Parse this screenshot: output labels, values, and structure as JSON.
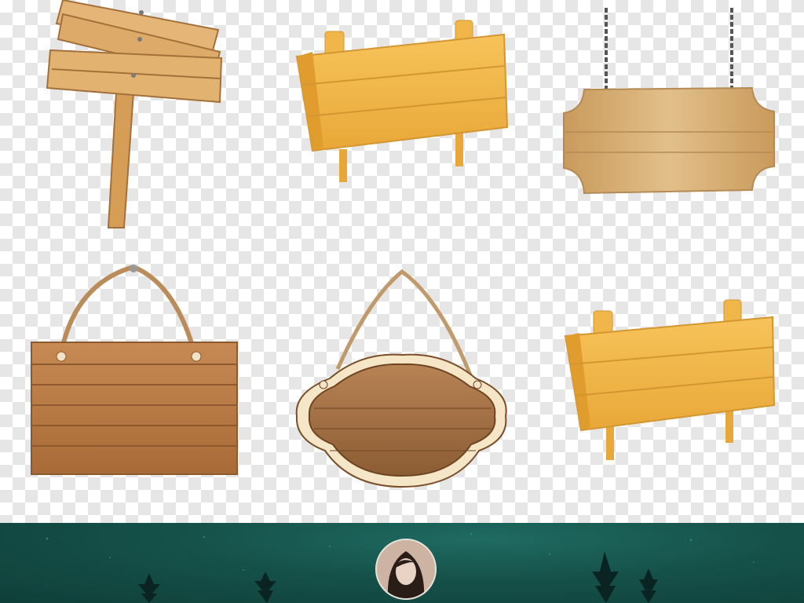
{
  "page": {
    "description": ""
  },
  "images": [
    {
      "name": "wooden-signpost-stacked"
    },
    {
      "name": "wooden-sign-board-yellow"
    },
    {
      "name": "wooden-sign-hanging-chains"
    },
    {
      "name": "wooden-sign-hanging-rope"
    },
    {
      "name": "wooden-plaque-ornate-rope"
    },
    {
      "name": "wooden-sign-board-yellow-2"
    }
  ],
  "footer": {
    "avatar_icon": "user-avatar-icon"
  },
  "colors": {
    "checker_light": "#ffffff",
    "checker_dark": "#e6e6e6",
    "wood_yellow": "#f2b84b",
    "wood_brown": "#b9783f",
    "footer_teal": "#155149"
  }
}
